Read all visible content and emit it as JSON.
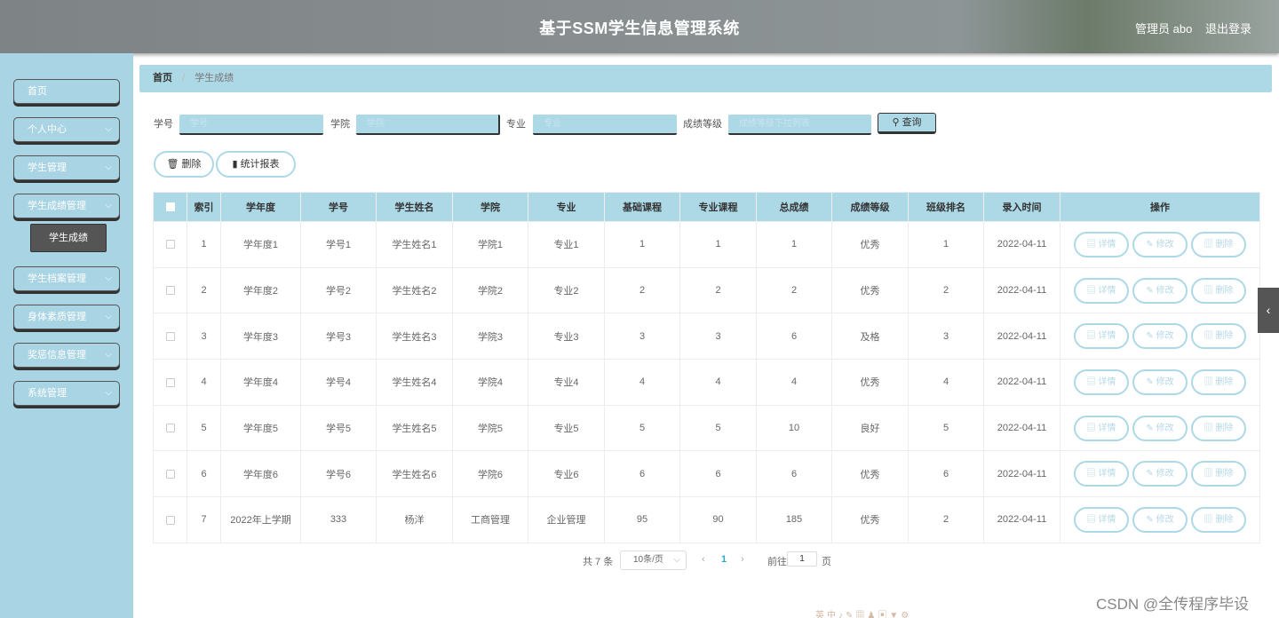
{
  "header": {
    "title": "基于SSM学生信息管理系统",
    "user": "管理员 abo",
    "logout": "退出登录"
  },
  "sidebar": {
    "items": [
      {
        "label": "首页"
      },
      {
        "label": "个人中心"
      },
      {
        "label": "学生管理"
      },
      {
        "label": "学生成绩管理"
      },
      {
        "label": "学生档案管理"
      },
      {
        "label": "身体素质管理"
      },
      {
        "label": "奖惩信息管理"
      },
      {
        "label": "系统管理"
      }
    ],
    "active_sub": "学生成绩",
    "chevron": "⌵"
  },
  "breadcrumb": {
    "home": "首页",
    "sep": "/",
    "current": "学生成绩"
  },
  "search": {
    "student_no_label": "学号",
    "student_no_placeholder": "学号",
    "college_label": "学院",
    "college_placeholder": "学院",
    "major_label": "专业",
    "major_placeholder": "专业",
    "grade_label": "成绩等级",
    "grade_placeholder": "成绩等级下拉列表",
    "query": "查询"
  },
  "actions": {
    "delete": "删除",
    "stats": "统计报表"
  },
  "table": {
    "headers": [
      "索引",
      "学年度",
      "学号",
      "学生姓名",
      "学院",
      "专业",
      "基础课程",
      "专业课程",
      "总成绩",
      "成绩等级",
      "班级排名",
      "录入时间",
      "操作"
    ],
    "rows": [
      [
        "1",
        "学年度1",
        "学号1",
        "学生姓名1",
        "学院1",
        "专业1",
        "1",
        "1",
        "1",
        "优秀",
        "1",
        "2022-04-11"
      ],
      [
        "2",
        "学年度2",
        "学号2",
        "学生姓名2",
        "学院2",
        "专业2",
        "2",
        "2",
        "2",
        "优秀",
        "2",
        "2022-04-11"
      ],
      [
        "3",
        "学年度3",
        "学号3",
        "学生姓名3",
        "学院3",
        "专业3",
        "3",
        "3",
        "6",
        "及格",
        "3",
        "2022-04-11"
      ],
      [
        "4",
        "学年度4",
        "学号4",
        "学生姓名4",
        "学院4",
        "专业4",
        "4",
        "4",
        "4",
        "优秀",
        "4",
        "2022-04-11"
      ],
      [
        "5",
        "学年度5",
        "学号5",
        "学生姓名5",
        "学院5",
        "专业5",
        "5",
        "5",
        "10",
        "良好",
        "5",
        "2022-04-11"
      ],
      [
        "6",
        "学年度6",
        "学号6",
        "学生姓名6",
        "学院6",
        "专业6",
        "6",
        "6",
        "6",
        "优秀",
        "6",
        "2022-04-11"
      ],
      [
        "7",
        "2022年上学期",
        "333",
        "杨洋",
        "工商管理",
        "企业管理",
        "95",
        "90",
        "185",
        "优秀",
        "2",
        "2022-04-11"
      ]
    ],
    "ops": {
      "detail": "详情",
      "edit": "修改",
      "delete": "删除"
    }
  },
  "pagination": {
    "total": "共 7 条",
    "page_size": "10条/页",
    "prev": "‹",
    "current": "1",
    "next": "›",
    "goto": "前往",
    "goto_value": "1",
    "page_unit": "页"
  },
  "watermark": "CSDN @全传程序毕设",
  "toolbar_icons": "英中♪✎▦♟▣▼⚙"
}
